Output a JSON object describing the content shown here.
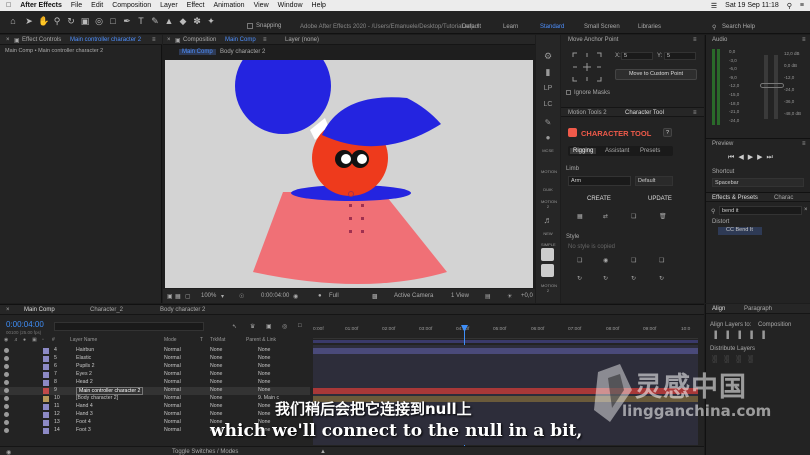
{
  "menubar": {
    "app": "After Effects",
    "items": [
      "File",
      "Edit",
      "Composition",
      "Layer",
      "Effect",
      "Animation",
      "View",
      "Window",
      "Help"
    ],
    "datetime": "Sat 19 Sep  11:18"
  },
  "titlebar": {
    "path": "Adobe After Effects 2020 - /Users/Emanuele/Desktop/Tutorial.aep *",
    "workspaces": [
      "Default",
      "Learn",
      "Standard",
      "Small Screen",
      "Libraries"
    ],
    "active_workspace": "Standard",
    "snapping": "Snapping",
    "search_help": "Search Help"
  },
  "effect_controls": {
    "tab": "Effect Controls",
    "tab_target": "Main controller character 2",
    "breadcrumb": "Main Comp • Main controller character 2"
  },
  "composition": {
    "tab": "Composition",
    "tab_target": "Main Comp",
    "layer_tab": "Layer (none)",
    "subtabs": [
      "Main Comp",
      "Body character 2"
    ],
    "zoom": "100%",
    "timecode": "0:00:04:00",
    "resolution": "Full",
    "camera": "Active Camera",
    "view": "1 View"
  },
  "toolcol": [
    "LP",
    "LC",
    "MCSE",
    "MOTION",
    "DUIK",
    "MOTION 2",
    "NEW",
    "SIMPLE",
    "MOTION 2"
  ],
  "move_anchor": {
    "title": "Move Anchor Point",
    "x_label": "X:",
    "x_value": "5",
    "y_label": "Y:",
    "y_value": "5",
    "button": "Move to Custom Point",
    "ignore_masks": "Ignore Masks"
  },
  "character_tool": {
    "tabs": [
      "Motion Tools 2",
      "Character Tool"
    ],
    "active_tab": "Character Tool",
    "title": "CHARACTER TOOL",
    "help": "?",
    "subtabs": [
      "Rigging",
      "Assistant",
      "Presets"
    ],
    "limb_label": "Limb",
    "limb_value": "Arm",
    "limb_preset": "Default",
    "create": "CREATE",
    "update": "UPDATE",
    "style_label": "Style",
    "style_value": "No style is copied"
  },
  "audio": {
    "title": "Audio",
    "db_left": [
      "0,0",
      "-3,0",
      "-6,0",
      "-9,0",
      "-12,0",
      "-15,0",
      "-18,0",
      "-21,0",
      "-24,0"
    ],
    "db_right": [
      "12,0 dB",
      "0,0 dB",
      "-12,0",
      "-24,0",
      "-36,0",
      "-48,0 dB"
    ]
  },
  "preview": {
    "title": "Preview",
    "shortcut_label": "Shortcut",
    "shortcut_value": "Spacebar"
  },
  "effects_presets": {
    "tabs": [
      "Effects & Presets",
      "Charac"
    ],
    "search": "bend it",
    "category": "Distort",
    "item": "CC Bend It"
  },
  "timeline": {
    "tabs": [
      "Main Comp",
      "Character_2",
      "Body character 2"
    ],
    "timecode": "0:00:04:00",
    "fps": "00100 (25.00 fps)",
    "headers": [
      "#",
      "Layer Name",
      "Mode",
      "T",
      "TrkMat",
      "Parent & Link"
    ],
    "ruler": [
      "0:00f",
      "01:00f",
      "02:00f",
      "03:00f",
      "04:00f",
      "05:00f",
      "06:00f",
      "07:00f",
      "08:00f",
      "09:00f",
      "10:0"
    ],
    "rows": [
      {
        "num": "4",
        "name": "Hairbun",
        "mode": "Normal",
        "trk": "None",
        "parent": "None"
      },
      {
        "num": "5",
        "name": "Elastic",
        "mode": "Normal",
        "trk": "None",
        "parent": "None"
      },
      {
        "num": "6",
        "name": "Pupils 2",
        "mode": "Normal",
        "trk": "None",
        "parent": "None"
      },
      {
        "num": "7",
        "name": "Eyes 2",
        "mode": "Normal",
        "trk": "None",
        "parent": "None"
      },
      {
        "num": "8",
        "name": "Head 2",
        "mode": "Normal",
        "trk": "None",
        "parent": "None"
      },
      {
        "num": "9",
        "name": "Main controller character 2",
        "mode": "Normal",
        "trk": "None",
        "parent": "None"
      },
      {
        "num": "10",
        "name": "[Body character 2]",
        "mode": "Normal",
        "trk": "None",
        "parent": "9. Main c"
      },
      {
        "num": "11",
        "name": "Hand 4",
        "mode": "Normal",
        "trk": "None",
        "parent": "None"
      },
      {
        "num": "12",
        "name": "Hand 3",
        "mode": "Normal",
        "trk": "None",
        "parent": "None"
      },
      {
        "num": "13",
        "name": "Foot 4",
        "mode": "Normal",
        "trk": "None",
        "parent": "None"
      },
      {
        "num": "14",
        "name": "Foot 3",
        "mode": "Normal",
        "trk": "None",
        "parent": "None"
      }
    ],
    "footer": "Toggle Switches / Modes"
  },
  "align": {
    "tabs": [
      "Align",
      "Paragraph"
    ],
    "align_layers_to": "Align Layers to:",
    "align_target": "Composition",
    "distribute": "Distribute Layers"
  },
  "subtitles": {
    "cn": "我们稍后会把它连接到null上",
    "en": "which we'll connect to the null in a bit,"
  },
  "watermark": {
    "cn": "灵感中国",
    "en": "lingganchina.com"
  },
  "colors": {
    "accent": "#3f8ef7",
    "character_tool": "#f05a4a",
    "body_pink": "#f07076",
    "hat_blue": "#2424e0",
    "head_red": "#ee3a1c"
  }
}
